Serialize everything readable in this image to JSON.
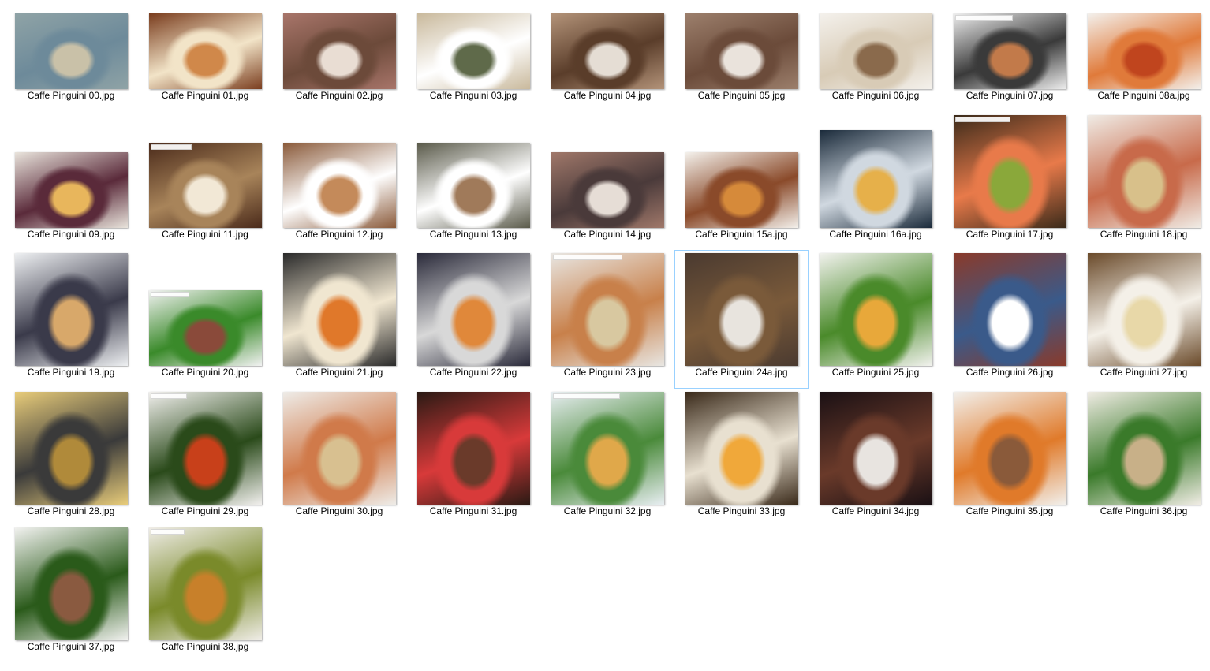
{
  "folder": {
    "files": [
      {
        "name": "Caffe Pinguini 00.jpg",
        "icon": "aerial-map-thumbnail",
        "colors": [
          "#8fa3a6",
          "#c9c1a8",
          "#6d8a9a"
        ]
      },
      {
        "name": "Caffe Pinguini 01.jpg",
        "icon": "restaurant-interior-thumbnail",
        "colors": [
          "#7a3d1e",
          "#d0884a",
          "#f2e4c8"
        ]
      },
      {
        "name": "Caffe Pinguini 02.jpg",
        "icon": "restaurant-interior-thumbnail",
        "colors": [
          "#a8756a",
          "#e9ddd3",
          "#6c4a3a"
        ]
      },
      {
        "name": "Caffe Pinguini 03.jpg",
        "icon": "patio-dining-thumbnail",
        "colors": [
          "#c9b99c",
          "#5f6a4a",
          "#ffffff"
        ]
      },
      {
        "name": "Caffe Pinguini 04.jpg",
        "icon": "restaurant-interior-thumbnail",
        "colors": [
          "#b39379",
          "#e5ddd4",
          "#5a3d2a"
        ]
      },
      {
        "name": "Caffe Pinguini 05.jpg",
        "icon": "restaurant-collage-thumbnail",
        "colors": [
          "#9c7f6c",
          "#eae3dc",
          "#6b4b3a"
        ]
      },
      {
        "name": "Caffe Pinguini 06.jpg",
        "icon": "risotto-plate-thumbnail",
        "colors": [
          "#f4f1ec",
          "#8a6a4c",
          "#d8cbb6"
        ]
      },
      {
        "name": "Caffe Pinguini 07.jpg",
        "icon": "seafood-pasta-thumbnail",
        "colors": [
          "#eeeeee",
          "#c27a4a",
          "#3a3a3a"
        ]
      },
      {
        "name": "Caffe Pinguini 08a.jpg",
        "icon": "bolognese-pasta-thumbnail",
        "colors": [
          "#f3f0ec",
          "#c0451e",
          "#e07a3a"
        ]
      },
      {
        "name": "Caffe Pinguini 09.jpg",
        "icon": "pizza-thumbnail",
        "colors": [
          "#e9e4dc",
          "#e8b65c",
          "#5a2a3a"
        ]
      },
      {
        "name": "Caffe Pinguini 11.jpg",
        "icon": "pasta-plate-thumbnail",
        "colors": [
          "#4a2a1a",
          "#f2e8d6",
          "#a8845a"
        ]
      },
      {
        "name": "Caffe Pinguini 12.jpg",
        "icon": "patio-dining-thumbnail",
        "colors": [
          "#8a5a3a",
          "#c48a5a",
          "#ffffff"
        ]
      },
      {
        "name": "Caffe Pinguini 13.jpg",
        "icon": "patio-dining-thumbnail",
        "colors": [
          "#5a5a4a",
          "#a07a5a",
          "#ffffff"
        ]
      },
      {
        "name": "Caffe Pinguini 14.jpg",
        "icon": "restaurant-interior-thumbnail",
        "colors": [
          "#a0786a",
          "#e6ddd6",
          "#4a3a3a"
        ]
      },
      {
        "name": "Caffe Pinguini 15a.jpg",
        "icon": "pasta-plate-thumbnail",
        "colors": [
          "#f4f1ec",
          "#d68a3a",
          "#8a4a2a"
        ]
      },
      {
        "name": "Caffe Pinguini 16a.jpg",
        "icon": "pasta-plate-thumbnail",
        "colors": [
          "#1a2a3a",
          "#e6b04a",
          "#d0d8e0"
        ]
      },
      {
        "name": "Caffe Pinguini 17.jpg",
        "icon": "pesto-shrimp-pasta-thumbnail",
        "colors": [
          "#3a2a1a",
          "#8aa83a",
          "#e87a4a"
        ]
      },
      {
        "name": "Caffe Pinguini 18.jpg",
        "icon": "seafood-pasta-thumbnail",
        "colors": [
          "#f0ece6",
          "#d8c08a",
          "#c86a4a"
        ]
      },
      {
        "name": "Caffe Pinguini 19.jpg",
        "icon": "seafood-pasta-thumbnail",
        "colors": [
          "#eef0f2",
          "#d8a86a",
          "#3a3a4a"
        ]
      },
      {
        "name": "Caffe Pinguini 20.jpg",
        "icon": "steak-plate-thumbnail",
        "colors": [
          "#f2f2f2",
          "#8a4a3a",
          "#3a8a2a"
        ]
      },
      {
        "name": "Caffe Pinguini 21.jpg",
        "icon": "shrimp-pasta-thumbnail",
        "colors": [
          "#2a2a2a",
          "#e0782a",
          "#f0e6d0"
        ]
      },
      {
        "name": "Caffe Pinguini 22.jpg",
        "icon": "seafood-pasta-thumbnail",
        "colors": [
          "#2a2a3a",
          "#e0883a",
          "#d8d8d8"
        ]
      },
      {
        "name": "Caffe Pinguini 23.jpg",
        "icon": "seafood-pasta-thumbnail",
        "colors": [
          "#e8e6e2",
          "#d8c8a0",
          "#c8804a"
        ]
      },
      {
        "name": "Caffe Pinguini 24a.jpg",
        "icon": "steak-dinner-thumbnail",
        "colors": [
          "#4a3a30",
          "#e8e4de",
          "#7a5a3a"
        ]
      },
      {
        "name": "Caffe Pinguini 25.jpg",
        "icon": "chicken-vegetables-thumbnail",
        "colors": [
          "#f2f2ee",
          "#e8a83a",
          "#4a8a2a"
        ]
      },
      {
        "name": "Caffe Pinguini 26.jpg",
        "icon": "banquet-table-thumbnail",
        "colors": [
          "#8a3a2a",
          "#ffffff",
          "#3a5a8a"
        ]
      },
      {
        "name": "Caffe Pinguini 27.jpg",
        "icon": "ravioli-flour-thumbnail",
        "colors": [
          "#6a4a2a",
          "#e8d8a8",
          "#f4f0e8"
        ]
      },
      {
        "name": "Caffe Pinguini 28.jpg",
        "icon": "tortellini-thumbnail",
        "colors": [
          "#e8cc7a",
          "#b08a3a",
          "#3a3a3a"
        ]
      },
      {
        "name": "Caffe Pinguini 29.jpg",
        "icon": "chicken-parmigiana-thumbnail",
        "colors": [
          "#f2f0ee",
          "#c8401a",
          "#2a4a1a"
        ]
      },
      {
        "name": "Caffe Pinguini 30.jpg",
        "icon": "seafood-pasta-thumbnail",
        "colors": [
          "#eeece8",
          "#d8c090",
          "#d07a4a"
        ]
      },
      {
        "name": "Caffe Pinguini 31.jpg",
        "icon": "chocolate-cake-thumbnail",
        "colors": [
          "#2a1a14",
          "#6a3a2a",
          "#d83a3a"
        ]
      },
      {
        "name": "Caffe Pinguini 32.jpg",
        "icon": "fish-plate-thumbnail",
        "colors": [
          "#e8eef2",
          "#e0a84a",
          "#4a8a3a"
        ]
      },
      {
        "name": "Caffe Pinguini 33.jpg",
        "icon": "pizza-thumbnail",
        "colors": [
          "#3a2a1a",
          "#f0a83a",
          "#e8e0d0"
        ]
      },
      {
        "name": "Caffe Pinguini 34.jpg",
        "icon": "steak-dinner-thumbnail",
        "colors": [
          "#1a1014",
          "#e8e4e0",
          "#6a3a2a"
        ]
      },
      {
        "name": "Caffe Pinguini 35.jpg",
        "icon": "roast-meat-thumbnail",
        "colors": [
          "#f2f0ec",
          "#8a5a3a",
          "#e07a2a"
        ]
      },
      {
        "name": "Caffe Pinguini 36.jpg",
        "icon": "chicken-cream-thumbnail",
        "colors": [
          "#f0ece4",
          "#c8b088",
          "#3a7a2a"
        ]
      },
      {
        "name": "Caffe Pinguini 37.jpg",
        "icon": "lamb-chops-thumbnail",
        "colors": [
          "#f2f2f0",
          "#8a5a40",
          "#2a5a1a"
        ]
      },
      {
        "name": "Caffe Pinguini 38.jpg",
        "icon": "braised-dish-thumbnail",
        "colors": [
          "#f0ede8",
          "#c8802a",
          "#7a8a2a"
        ]
      }
    ],
    "selected_file": "Caffe Pinguini 24a.jpg"
  }
}
